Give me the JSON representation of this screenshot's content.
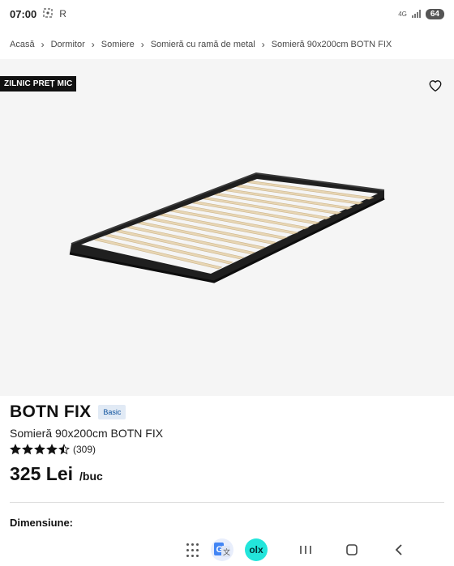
{
  "status_bar": {
    "time": "07:00",
    "icons": [
      "screenshot-icon",
      "r-icon"
    ],
    "r_label": "R",
    "network_label": "4G",
    "battery_level": "64"
  },
  "breadcrumb": [
    {
      "label": "Acasă"
    },
    {
      "label": "Dormitor"
    },
    {
      "label": "Somiere"
    },
    {
      "label": "Somieră cu ramă de metal"
    },
    {
      "label": "Somieră 90x200cm BOTN FIX"
    }
  ],
  "image_area": {
    "promo_badge": "ZILNIC PREȚ MIC",
    "favorite_icon": "heart-outline-icon"
  },
  "product": {
    "name": "BOTN FIX",
    "badge": "Basic",
    "description": "Somieră 90x200cm BOTN FIX",
    "rating": 4.5,
    "review_count": "(309)",
    "price": "325 Lei",
    "price_unit": "/buc",
    "dimension_label": "Dimensiune:"
  },
  "nav_bar": {
    "items": [
      "apps-icon",
      "google-translate-icon",
      "olx-icon",
      "recents-icon",
      "home-icon",
      "back-icon"
    ],
    "olx_label": "olx"
  },
  "colors": {
    "badge_bg": "#111111",
    "basic_badge_bg": "#e1eaf5",
    "basic_badge_text": "#0a4f9c",
    "image_bg": "#f5f5f5",
    "olx_bg": "#23e5db"
  }
}
